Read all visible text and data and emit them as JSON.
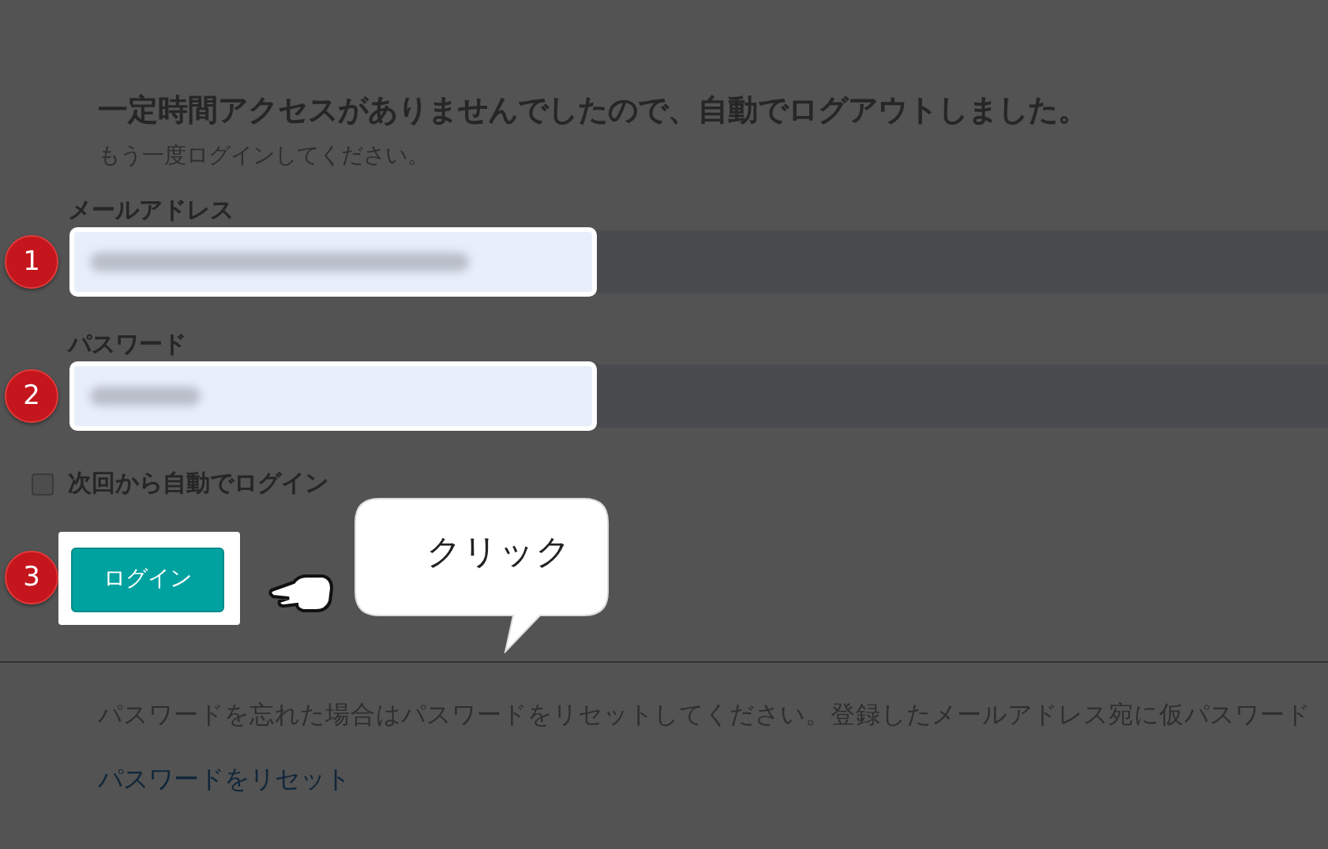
{
  "heading": "一定時間アクセスがありませんでしたので、自動でログアウトしました。",
  "subheading": "もう一度ログインしてください。",
  "fields": [
    {
      "label": "メールアドレス",
      "step": "1",
      "kind": "email"
    },
    {
      "label": "パスワード",
      "step": "2",
      "kind": "password"
    }
  ],
  "remember": {
    "label": "次回から自動でログイン",
    "checked": false
  },
  "login": {
    "label": "ログイン",
    "step": "3"
  },
  "callout": {
    "text": "クリック"
  },
  "reset_note": "パスワードを忘れた場合はパスワードをリセットしてください。登録したメールアドレス宛に仮パスワード",
  "reset_link": "パスワードをリセット"
}
